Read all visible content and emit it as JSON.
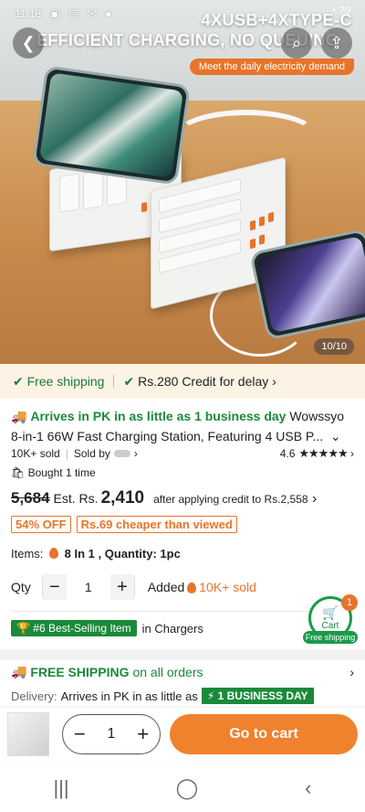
{
  "status_bar": {
    "time": "11:18",
    "battery": "70"
  },
  "hero": {
    "headline_1": "4XUSB+4XTYPE-C",
    "headline_2": "EFFICIENT CHARGING, NO QUEUING",
    "subline": "Meet the daily electricity demand",
    "image_counter": "10/10",
    "brand_print": "Wowssyo"
  },
  "shipping_bar": {
    "free_shipping": "Free shipping",
    "credit": "Rs.280 Credit for delay"
  },
  "product": {
    "arrival": "Arrives in PK in as little as 1 business day",
    "title": "Wowssyo 8-in-1 66W Fast Charging Station, Featuring 4 USB P...",
    "sold": "10K+ sold",
    "sold_by": "Sold by",
    "rating": "4.6",
    "rating_value": 4.6,
    "bought": "Bought 1 time",
    "price_old": "5,684",
    "est_label": "Est. Rs.",
    "price_now": "2,410",
    "after_credit": "after applying credit to Rs.2,558",
    "tag_off": "54% OFF",
    "tag_cheaper": "Rs.69 cheaper than viewed",
    "items_label": "Items:",
    "items_value": "8 In 1 , Quantity: 1pc",
    "qty_label": "Qty",
    "qty_value": "1",
    "added_label": "Added",
    "added_value": "10K+ sold",
    "best_badge": "#6 Best-Selling Item",
    "best_category": "in Chargers"
  },
  "cart_float": {
    "label": "Cart",
    "count": "1",
    "sub": "Free shipping"
  },
  "shipping_info": {
    "free_shipping": "FREE SHIPPING",
    "free_shipping_tail": "on all orders",
    "delivery_label": "Delivery:",
    "delivery_text": "Arrives in PK in as little as",
    "business_day": "1 BUSINESS DAY"
  },
  "bottom_bar": {
    "qty": "1",
    "go_cart": "Go to cart"
  },
  "colors": {
    "accent": "#f0822e",
    "green": "#1a8a3a",
    "ship_bg": "#fdf3e4"
  }
}
